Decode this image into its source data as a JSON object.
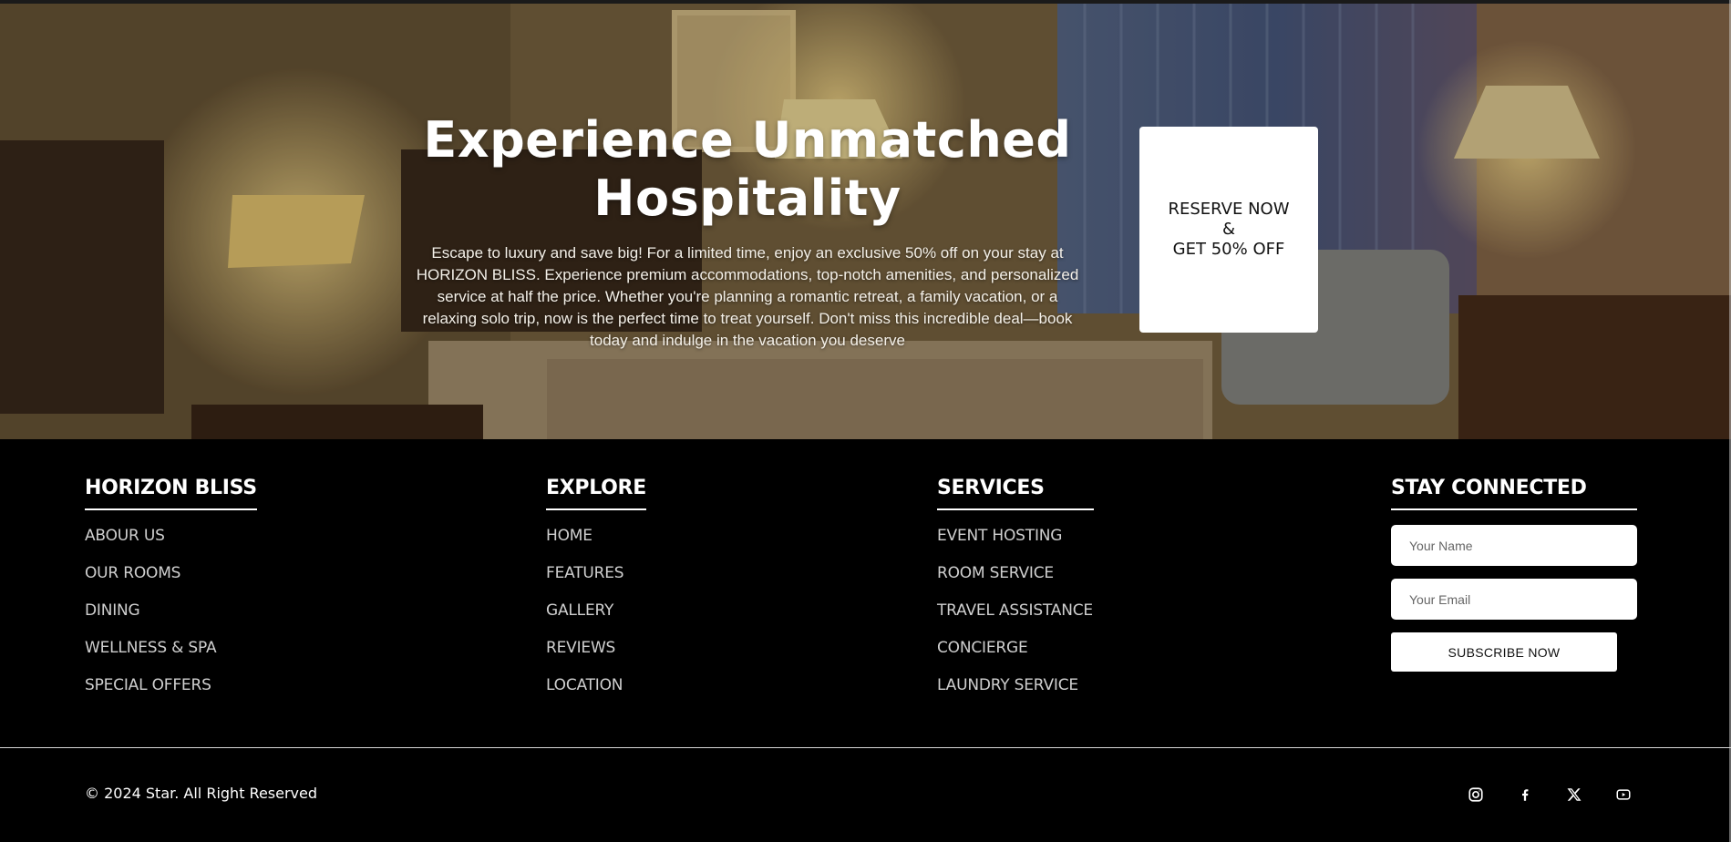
{
  "hero": {
    "title_line1": "Experience Unmatched",
    "title_line2": "Hospitality",
    "description": "Escape to luxury and save big! For a limited time, enjoy an exclusive 50% off on your stay at HORIZON BLISS. Experience premium accommodations, top-notch amenities, and personalized service at half the price. Whether you're planning a romantic retreat, a family vacation, or a relaxing solo trip, now is the perfect time to treat yourself. Don't miss this incredible deal—book today and indulge in the vacation you deserve",
    "reserve_line1": "RESERVE NOW",
    "reserve_line2": "&",
    "reserve_line3": "GET 50% OFF",
    "background_image": "hotel-room-photo"
  },
  "footer": {
    "brand": {
      "title": "HORIZON BLISS",
      "links": [
        "ABOUR US",
        "OUR ROOMS",
        "DINING",
        "WELLNESS & SPA",
        "SPECIAL OFFERS"
      ]
    },
    "explore": {
      "title": "EXPLORE",
      "links": [
        "HOME",
        "FEATURES",
        "GALLERY",
        "REVIEWS",
        "LOCATION"
      ]
    },
    "services": {
      "title": "SERVICES",
      "links": [
        "EVENT HOSTING",
        "ROOM SERVICE",
        "TRAVEL ASSISTANCE",
        "CONCIERGE",
        "LAUNDRY SERVICE"
      ]
    },
    "connect": {
      "title": "STAY CONNECTED",
      "name_placeholder": "Your Name",
      "email_placeholder": "Your Email",
      "subscribe_label": "SUBSCRIBE NOW"
    },
    "copyright": "© 2024 Star. All Right Reserved",
    "socials": [
      "instagram-icon",
      "facebook-icon",
      "x-icon",
      "youtube-icon"
    ]
  },
  "colors": {
    "background": "#000000",
    "text": "#ffffff",
    "link": "#cfcfcf",
    "button_bg": "#ffffff"
  }
}
